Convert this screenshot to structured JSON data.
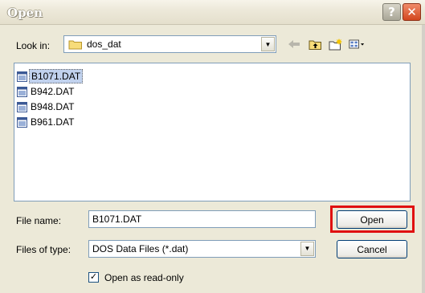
{
  "window": {
    "title": "Open",
    "help_glyph": "?",
    "close_glyph": "✕"
  },
  "look_in": {
    "label": "Look in:",
    "folder": "dos_dat"
  },
  "toolbar": {
    "icons": [
      "back-arrow-icon",
      "up-folder-icon",
      "new-folder-icon",
      "view-menu-icon"
    ]
  },
  "files": [
    {
      "name": "B1071.DAT",
      "selected": true
    },
    {
      "name": "B942.DAT",
      "selected": false
    },
    {
      "name": "B948.DAT",
      "selected": false
    },
    {
      "name": "B961.DAT",
      "selected": false
    }
  ],
  "file_name": {
    "label": "File name:",
    "value": "B1071.DAT"
  },
  "files_of_type": {
    "label": "Files of type:",
    "value": "DOS Data Files (*.dat)"
  },
  "buttons": {
    "open": "Open",
    "cancel": "Cancel"
  },
  "read_only": {
    "label": "Open as read-only",
    "checked": true,
    "check_glyph": "✓"
  },
  "colors": {
    "highlight_border": "#e01010",
    "selection": "#c1d2ee"
  }
}
